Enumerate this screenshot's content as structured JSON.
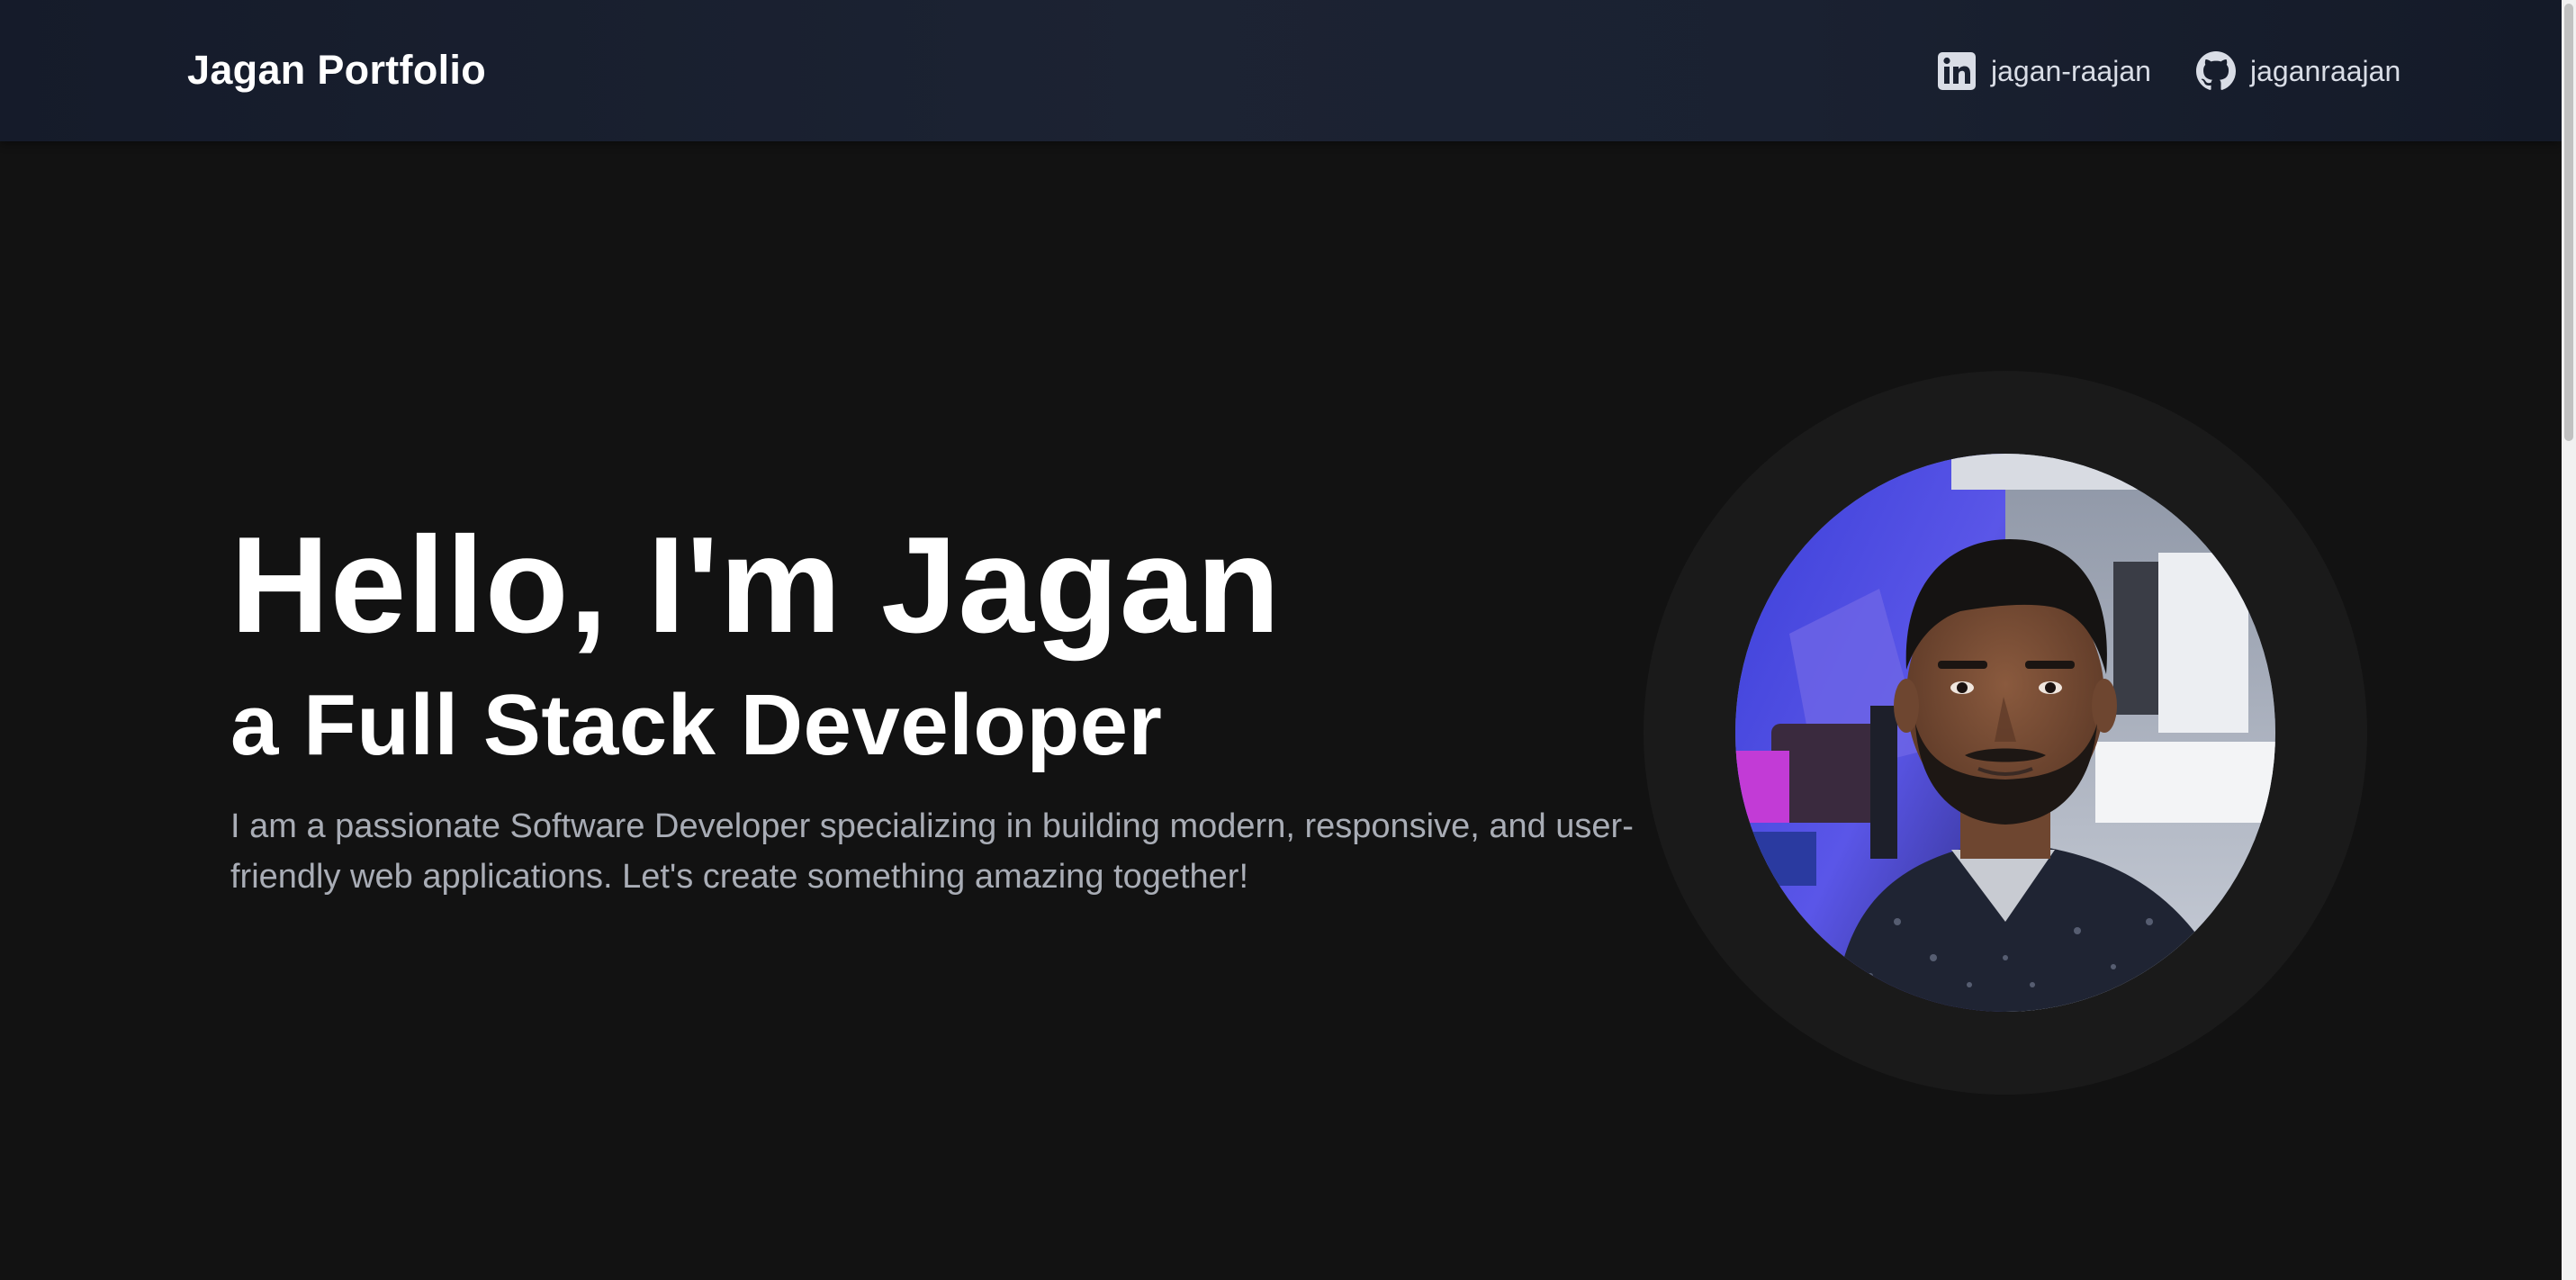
{
  "header": {
    "brand": "Jagan Portfolio",
    "links": [
      {
        "label": "jagan-raajan",
        "icon": "linkedin-icon"
      },
      {
        "label": "jaganraajan",
        "icon": "github-icon"
      }
    ]
  },
  "hero": {
    "title": "Hello, I'm Jagan",
    "subtitle": "a Full Stack Developer",
    "description": "I am a passionate Software Developer specializing in building modern, responsive, and user-friendly web applications. Let's create something amazing together!",
    "photo_alt": "Portrait photo of Jagan"
  },
  "colors": {
    "background": "#121212",
    "navbar": "#1c2333",
    "text": "#ffffff",
    "muted": "#a9adb6",
    "ring": "#1a1a1a"
  }
}
